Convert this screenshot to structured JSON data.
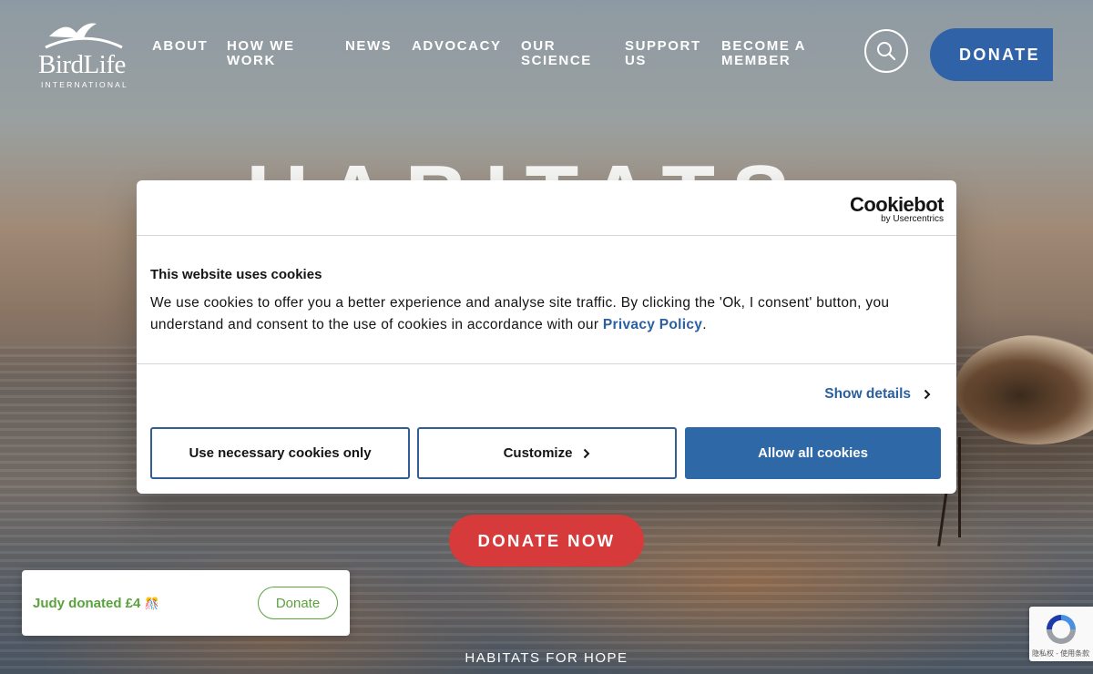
{
  "header": {
    "logo_text": "BirdLife",
    "logo_sub": "INTERNATIONAL",
    "nav": [
      {
        "label": "ABOUT"
      },
      {
        "label": "HOW WE WORK"
      },
      {
        "label": "NEWS"
      },
      {
        "label": "ADVOCACY"
      },
      {
        "label": "OUR SCIENCE"
      },
      {
        "label": "SUPPORT US"
      },
      {
        "label": "BECOME A MEMBER"
      }
    ],
    "donate_label": "DONATE",
    "search_icon": "search-icon"
  },
  "hero": {
    "title": "HABITATS",
    "donate_now_label": "DONATE NOW",
    "subtitle": "HABITATS FOR HOPE"
  },
  "cookie_dialog": {
    "brand_name": "Cookiebot",
    "brand_by": "by Usercentrics",
    "heading": "This website uses cookies",
    "body_text": "We use cookies to offer you a better experience and analyse site traffic. By clicking the 'Ok, I consent' button, you understand and consent to the use of cookies in accordance with our ",
    "privacy_link": "Privacy Policy",
    "body_end": ".",
    "show_details_label": "Show details",
    "buttons": {
      "necessary": "Use necessary cookies only",
      "customize": "Customize",
      "allow_all": "Allow all cookies"
    }
  },
  "donation_toast": {
    "text": "Judy donated £4",
    "emoji": "🎊",
    "button_label": "Donate"
  },
  "recaptcha": {
    "text": "隐私权 - 使用条款"
  },
  "colors": {
    "brand_blue": "#2f62a6",
    "donate_red": "#d73a3a",
    "toast_green": "#5aa33c"
  }
}
